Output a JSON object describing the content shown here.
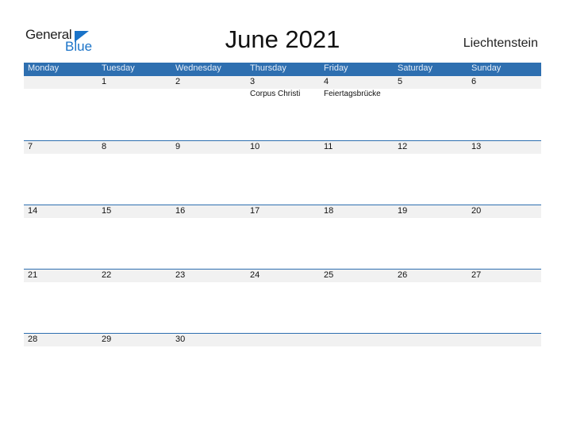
{
  "logo": {
    "line1": "General",
    "line2": "Blue"
  },
  "title": "June 2021",
  "country": "Liechtenstein",
  "colors": {
    "accent": "#2e6fb0",
    "strip": "#f1f1f1"
  },
  "weekdays": [
    "Monday",
    "Tuesday",
    "Wednesday",
    "Thursday",
    "Friday",
    "Saturday",
    "Sunday"
  ],
  "weeks": [
    {
      "days": [
        "",
        "1",
        "2",
        "3",
        "4",
        "5",
        "6"
      ],
      "holidays": [
        "",
        "",
        "",
        "Corpus Christi",
        "Feiertagsbrücke",
        "",
        ""
      ]
    },
    {
      "days": [
        "7",
        "8",
        "9",
        "10",
        "11",
        "12",
        "13"
      ],
      "holidays": [
        "",
        "",
        "",
        "",
        "",
        "",
        ""
      ]
    },
    {
      "days": [
        "14",
        "15",
        "16",
        "17",
        "18",
        "19",
        "20"
      ],
      "holidays": [
        "",
        "",
        "",
        "",
        "",
        "",
        ""
      ]
    },
    {
      "days": [
        "21",
        "22",
        "23",
        "24",
        "25",
        "26",
        "27"
      ],
      "holidays": [
        "",
        "",
        "",
        "",
        "",
        "",
        ""
      ]
    },
    {
      "days": [
        "28",
        "29",
        "30",
        "",
        "",
        "",
        ""
      ],
      "holidays": [
        "",
        "",
        "",
        "",
        "",
        "",
        ""
      ]
    }
  ]
}
